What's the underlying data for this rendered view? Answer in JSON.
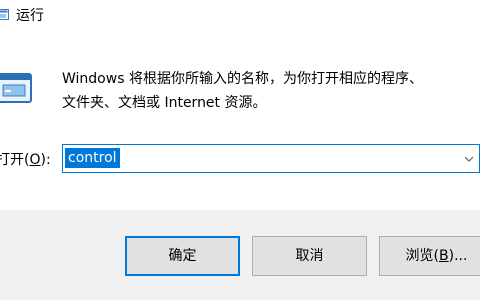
{
  "window": {
    "title": "运行",
    "title_icon": "run-icon"
  },
  "description": {
    "line1": "Windows 将根据你所输入的名称，为你打开相应的程序、",
    "line2": "文件夹、文档或 Internet 资源。"
  },
  "open": {
    "label_prefix": "打开(",
    "label_accel": "O",
    "label_suffix": "):",
    "value": "control",
    "dropdown_icon": "chevron-down-icon"
  },
  "buttons": {
    "ok": "确定",
    "cancel": "取消",
    "browse_prefix": "浏览(",
    "browse_accel": "B",
    "browse_suffix": ")..."
  },
  "colors": {
    "accent": "#0078d7",
    "footer_bg": "#f0f0f0",
    "button_bg": "#e1e1e1"
  }
}
